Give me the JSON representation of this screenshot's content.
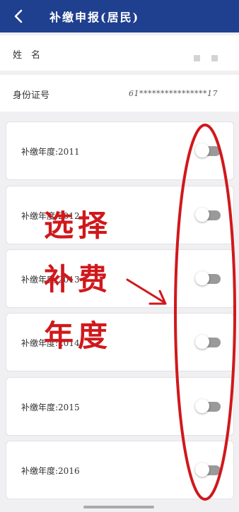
{
  "header": {
    "title": "补缴申报(居民)",
    "back_icon": "chevron-left-icon"
  },
  "info": {
    "name_label": "姓　名",
    "id_label": "身份证号",
    "id_value": "61****************17"
  },
  "years": [
    {
      "label": "补缴年度:2011",
      "enabled": false
    },
    {
      "label": "补缴年度:2012",
      "enabled": false
    },
    {
      "label": "补缴年度:2013",
      "enabled": false
    },
    {
      "label": "补缴年度:2014",
      "enabled": false
    },
    {
      "label": "补缴年度:2015",
      "enabled": false
    },
    {
      "label": "补缴年度:2016",
      "enabled": false
    }
  ],
  "annotation": {
    "line1": "选择",
    "line2": "补费",
    "line3": "年度"
  },
  "colors": {
    "header_bg": "#1f3f8f",
    "annotation": "#d0181c",
    "toggle_off": "#9a9a9a"
  }
}
